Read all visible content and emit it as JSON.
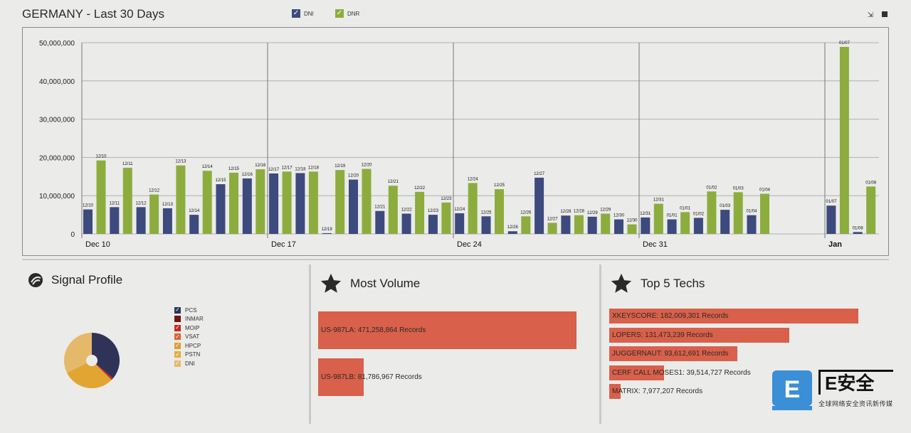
{
  "header": {
    "title": "GERMANY - Last 30 Days",
    "legend": [
      {
        "label": "DNI",
        "color": "#3d4a7d"
      },
      {
        "label": "DNR",
        "color": "#8cad3d"
      }
    ],
    "tools": {
      "left_icon": "move-icon",
      "right_icon": "stop-icon"
    }
  },
  "chart_data": {
    "type": "bar",
    "x_tick_labels": [
      "Dec 10",
      "Dec 17",
      "Dec 24",
      "Dec 31",
      "Jan"
    ],
    "y_tick_labels": [
      "0",
      "10,000,000",
      "20,000,000",
      "30,000,000",
      "40,000,000",
      "50,000,000"
    ],
    "ylim": [
      0,
      52000000
    ],
    "grid": true,
    "legend_position": "top",
    "series_colors": {
      "DNI": "#3d4a7d",
      "DNR": "#8cad3d"
    },
    "bars": [
      {
        "label": "12/10",
        "series": "DNI",
        "value": 6400000
      },
      {
        "label": "12/10",
        "series": "DNR",
        "value": 19200000
      },
      {
        "label": "12/11",
        "series": "DNI",
        "value": 7000000
      },
      {
        "label": "12/11",
        "series": "DNR",
        "value": 17300000
      },
      {
        "label": "12/12",
        "series": "DNI",
        "value": 7000000
      },
      {
        "label": "12/12",
        "series": "DNR",
        "value": 10300000
      },
      {
        "label": "12/13",
        "series": "DNI",
        "value": 6700000
      },
      {
        "label": "12/13",
        "series": "DNR",
        "value": 17900000
      },
      {
        "label": "12/14",
        "series": "DNI",
        "value": 5000000
      },
      {
        "label": "12/14",
        "series": "DNR",
        "value": 16500000
      },
      {
        "label": "12/15",
        "series": "DNI",
        "value": 13000000
      },
      {
        "label": "12/15",
        "series": "DNR",
        "value": 16000000
      },
      {
        "label": "12/16",
        "series": "DNI",
        "value": 14500000
      },
      {
        "label": "12/16",
        "series": "DNR",
        "value": 16900000
      },
      {
        "label": "12/17",
        "series": "DNI",
        "value": 15800000
      },
      {
        "label": "12/17",
        "series": "DNR",
        "value": 16300000
      },
      {
        "label": "12/18",
        "series": "DNI",
        "value": 15900000
      },
      {
        "label": "12/18",
        "series": "DNR",
        "value": 16300000
      },
      {
        "label": "12/19",
        "series": "DNI",
        "value": 200000
      },
      {
        "label": "12/19",
        "series": "DNR",
        "value": 16700000
      },
      {
        "label": "12/20",
        "series": "DNI",
        "value": 14200000
      },
      {
        "label": "12/20",
        "series": "DNR",
        "value": 17000000
      },
      {
        "label": "12/21",
        "series": "DNI",
        "value": 6000000
      },
      {
        "label": "12/21",
        "series": "DNR",
        "value": 12600000
      },
      {
        "label": "12/22",
        "series": "DNI",
        "value": 5300000
      },
      {
        "label": "12/22",
        "series": "DNR",
        "value": 11000000
      },
      {
        "label": "12/23",
        "series": "DNI",
        "value": 5000000
      },
      {
        "label": "12/23",
        "series": "DNR",
        "value": 8200000
      },
      {
        "label": "12/24",
        "series": "DNI",
        "value": 5400000
      },
      {
        "label": "12/24",
        "series": "DNR",
        "value": 13300000
      },
      {
        "label": "12/25",
        "series": "DNI",
        "value": 4600000
      },
      {
        "label": "12/25",
        "series": "DNR",
        "value": 11700000
      },
      {
        "label": "12/26",
        "series": "DNI",
        "value": 700000
      },
      {
        "label": "12/26",
        "series": "DNR",
        "value": 4600000
      },
      {
        "label": "12/27",
        "series": "DNI",
        "value": 14700000
      },
      {
        "label": "12/27",
        "series": "DNR",
        "value": 2900000
      },
      {
        "label": "12/28",
        "series": "DNI",
        "value": 4800000
      },
      {
        "label": "12/28",
        "series": "DNR",
        "value": 4900000
      },
      {
        "label": "12/29",
        "series": "DNI",
        "value": 4500000
      },
      {
        "label": "12/29",
        "series": "DNR",
        "value": 5300000
      },
      {
        "label": "12/30",
        "series": "DNI",
        "value": 3800000
      },
      {
        "label": "12/30",
        "series": "DNR",
        "value": 2500000
      },
      {
        "label": "12/31",
        "series": "DNI",
        "value": 4300000
      },
      {
        "label": "12/31",
        "series": "DNR",
        "value": 7900000
      },
      {
        "label": "01/01",
        "series": "DNI",
        "value": 3800000
      },
      {
        "label": "01/01",
        "series": "DNR",
        "value": 5700000
      },
      {
        "label": "01/02",
        "series": "DNI",
        "value": 4200000
      },
      {
        "label": "01/02",
        "series": "DNR",
        "value": 11100000
      },
      {
        "label": "01/03",
        "series": "DNI",
        "value": 6300000
      },
      {
        "label": "01/03",
        "series": "DNR",
        "value": 10900000
      },
      {
        "label": "01/04",
        "series": "DNI",
        "value": 4900000
      },
      {
        "label": "01/04",
        "series": "DNR",
        "value": 10500000
      },
      {
        "label": "01/07",
        "series": "DNI",
        "value": 7400000
      },
      {
        "label": "01/07",
        "series": "DNR",
        "value": 48900000
      },
      {
        "label": "01/08",
        "series": "DNI",
        "value": 500000
      },
      {
        "label": "01/08",
        "series": "DNR",
        "value": 12400000
      }
    ]
  },
  "signal_profile": {
    "title": "Signal Profile",
    "legend": [
      {
        "label": "PCS",
        "color": "#2f3358"
      },
      {
        "label": "INMAR",
        "color": "#6e1515"
      },
      {
        "label": "MOIP",
        "color": "#c8281e"
      },
      {
        "label": "VSAT",
        "color": "#e0602a"
      },
      {
        "label": "HPCP",
        "color": "#e0a02f"
      },
      {
        "label": "PSTN",
        "color": "#e3ad3d"
      },
      {
        "label": "DNI",
        "color": "#e5b96a"
      }
    ],
    "pie_share_percent": {
      "PCS": 38,
      "MOIP": 1,
      "PSTN": 33,
      "DNI": 28
    }
  },
  "most_volume": {
    "title": "Most Volume",
    "items": [
      {
        "label": "US-987LA: 471,258,864 Records",
        "value": 471258864
      },
      {
        "label": "US-987LB: 81,786,967 Records",
        "value": 81786967
      }
    ]
  },
  "top_techs": {
    "title": "Top 5 Techs",
    "items": [
      {
        "label": "XKEYSCORE: 182,009,301 Records",
        "value": 182009301
      },
      {
        "label": "LOPERS: 131,473,239 Records",
        "value": 131473239
      },
      {
        "label": "JUGGERNAUT: 93,612,691 Records",
        "value": 93612691
      },
      {
        "label": "CERF CALL MOSES1: 39,514,727 Records",
        "value": 39514727
      },
      {
        "label": "MATRIX: 7,977,207 Records",
        "value": 7977207
      }
    ]
  },
  "accent_bar_color": "#d9604a",
  "watermark": {
    "logo_text": "E安全",
    "icon_letter": "E",
    "subtitle": "全球网络安全资讯新传媒"
  }
}
